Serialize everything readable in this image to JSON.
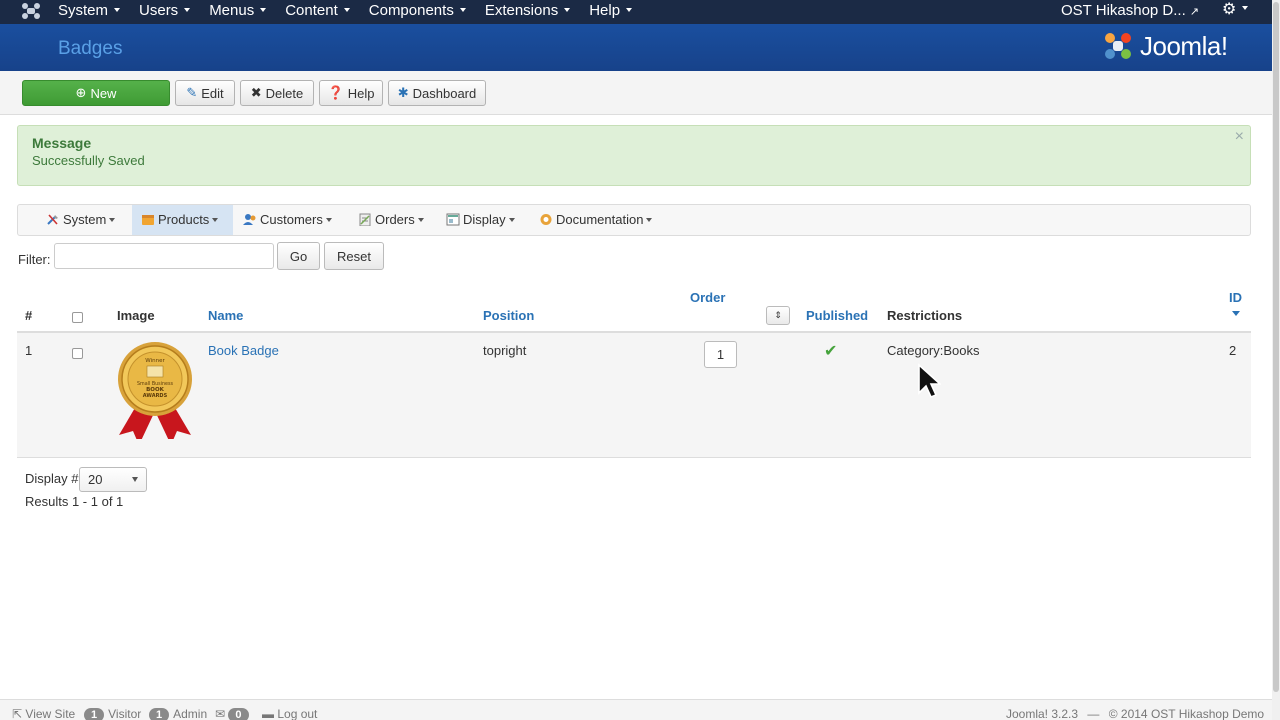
{
  "topbar": {
    "menu": [
      {
        "label": "System"
      },
      {
        "label": "Users"
      },
      {
        "label": "Menus"
      },
      {
        "label": "Content"
      },
      {
        "label": "Components"
      },
      {
        "label": "Extensions"
      },
      {
        "label": "Help"
      }
    ],
    "site_name": "OST Hikashop D...",
    "icons": [
      "joomla-icon",
      "external-link-icon",
      "gear-icon"
    ]
  },
  "header": {
    "title": "Badges",
    "logo_text": "Joomla!"
  },
  "toolbar": {
    "new_label": "New",
    "edit_label": "Edit",
    "delete_label": "Delete",
    "help_label": "Help",
    "dashboard_label": "Dashboard"
  },
  "message": {
    "heading": "Message",
    "text": "Successfully Saved",
    "close": "×"
  },
  "submenu": {
    "items": [
      {
        "label": "System",
        "icon": "tools-icon"
      },
      {
        "label": "Products",
        "icon": "box-icon"
      },
      {
        "label": "Customers",
        "icon": "users-icon"
      },
      {
        "label": "Orders",
        "icon": "clipboard-icon"
      },
      {
        "label": "Display",
        "icon": "display-icon"
      },
      {
        "label": "Documentation",
        "icon": "lifebuoy-icon"
      }
    ],
    "active_index": 1
  },
  "filter": {
    "label": "Filter:",
    "value": "",
    "go_label": "Go",
    "reset_label": "Reset"
  },
  "table": {
    "headers": {
      "num": "#",
      "image": "Image",
      "name": "Name",
      "position": "Position",
      "order": "Order",
      "published": "Published",
      "restrictions": "Restrictions",
      "id": "ID"
    },
    "rows": [
      {
        "num": "1",
        "image_text": [
          "Winner",
          "Small Business",
          "BOOK",
          "AWARDS"
        ],
        "name": "Book Badge",
        "position": "topright",
        "order": "1",
        "published": true,
        "restrictions": "Category:Books",
        "id": "2"
      }
    ]
  },
  "pagination": {
    "display_label": "Display #",
    "display_value": "20",
    "results": "Results 1 - 1 of 1"
  },
  "statusbar": {
    "view_site": "View Site",
    "visitor_count": "1",
    "visitor_label": "Visitor",
    "admin_count": "1",
    "admin_label": "Admin",
    "messages_count": "0",
    "logout_label": "Log out",
    "version": "Joomla! 3.2.3",
    "sep": "—",
    "copyright": "© 2014 OST Hikashop Demo"
  },
  "colors": {
    "topbar": "#1b2a45",
    "header": "#174aa0",
    "header_title": "#5aa0e6",
    "new_button": "#46a33c",
    "success_bg": "#dff0d8",
    "link": "#2a72b5"
  }
}
